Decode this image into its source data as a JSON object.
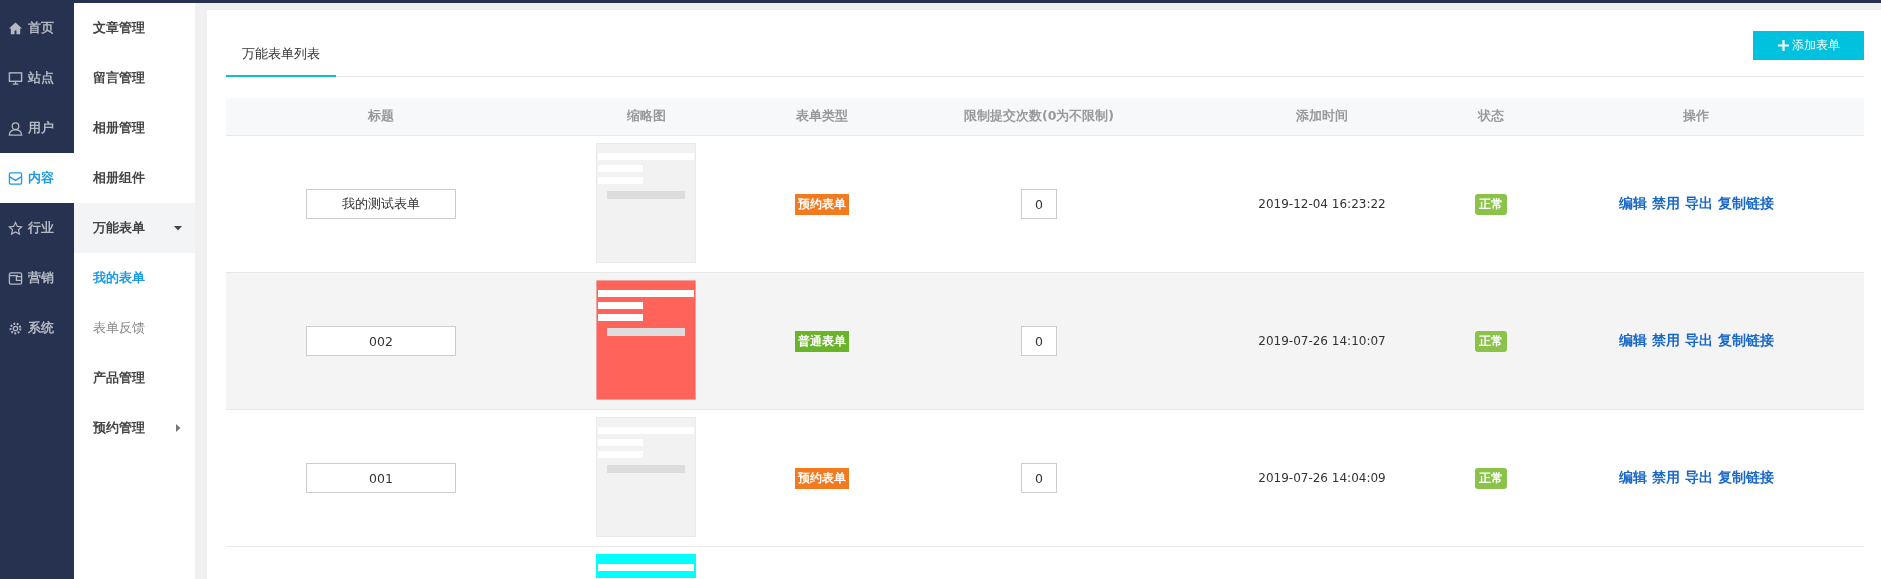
{
  "nav": {
    "items": [
      {
        "label": "首页",
        "selected": false
      },
      {
        "label": "站点",
        "selected": false
      },
      {
        "label": "用户",
        "selected": false
      },
      {
        "label": "内容",
        "selected": true
      },
      {
        "label": "行业",
        "selected": false
      },
      {
        "label": "营销",
        "selected": false
      },
      {
        "label": "系统",
        "selected": false
      }
    ]
  },
  "submenu": {
    "items": [
      {
        "label": "文章管理",
        "selected": false
      },
      {
        "label": "留言管理",
        "selected": false
      },
      {
        "label": "相册管理",
        "selected": false
      },
      {
        "label": "相册组件",
        "selected": false
      },
      {
        "label": "万能表单",
        "selected": false,
        "expanded": true,
        "children": [
          {
            "label": "我的表单",
            "selected": true
          },
          {
            "label": "表单反馈",
            "selected": false
          }
        ]
      },
      {
        "label": "产品管理",
        "selected": false
      },
      {
        "label": "预约管理",
        "selected": false,
        "expanded": false
      }
    ]
  },
  "tabs": [
    {
      "label": "万能表单列表",
      "selected": true
    }
  ],
  "add_button": {
    "label": "添加表单"
  },
  "table": {
    "columns": [
      "标题",
      "缩略图",
      "表单类型",
      "限制提交次数(0为不限制)",
      "添加时间",
      "状态",
      "操作"
    ],
    "rows": [
      {
        "title": "我的测试表单",
        "thumbnail": {
          "color": "#f2f2f2"
        },
        "form_type": {
          "label": "预约表单",
          "color": "#f47a1f"
        },
        "limit": "0",
        "added": "2019-12-04 16:23:22",
        "status": "正常",
        "actions": [
          "编辑",
          "禁用",
          "导出",
          "复制链接"
        ]
      },
      {
        "title": "002",
        "thumbnail": {
          "color": "#ff6359"
        },
        "form_type": {
          "label": "普通表单",
          "color": "#6ab42a"
        },
        "limit": "0",
        "added": "2019-07-26 14:10:07",
        "status": "正常",
        "actions": [
          "编辑",
          "禁用",
          "导出",
          "复制链接"
        ]
      },
      {
        "title": "001",
        "thumbnail": {
          "color": "#f2f2f2"
        },
        "form_type": {
          "label": "预约表单",
          "color": "#f47a1f"
        },
        "limit": "0",
        "added": "2019-07-26 14:04:09",
        "status": "正常",
        "actions": [
          "编辑",
          "禁用",
          "导出",
          "复制链接"
        ]
      }
    ],
    "partial_row": {
      "thumbnail": {
        "color": "#00ffff"
      }
    }
  }
}
